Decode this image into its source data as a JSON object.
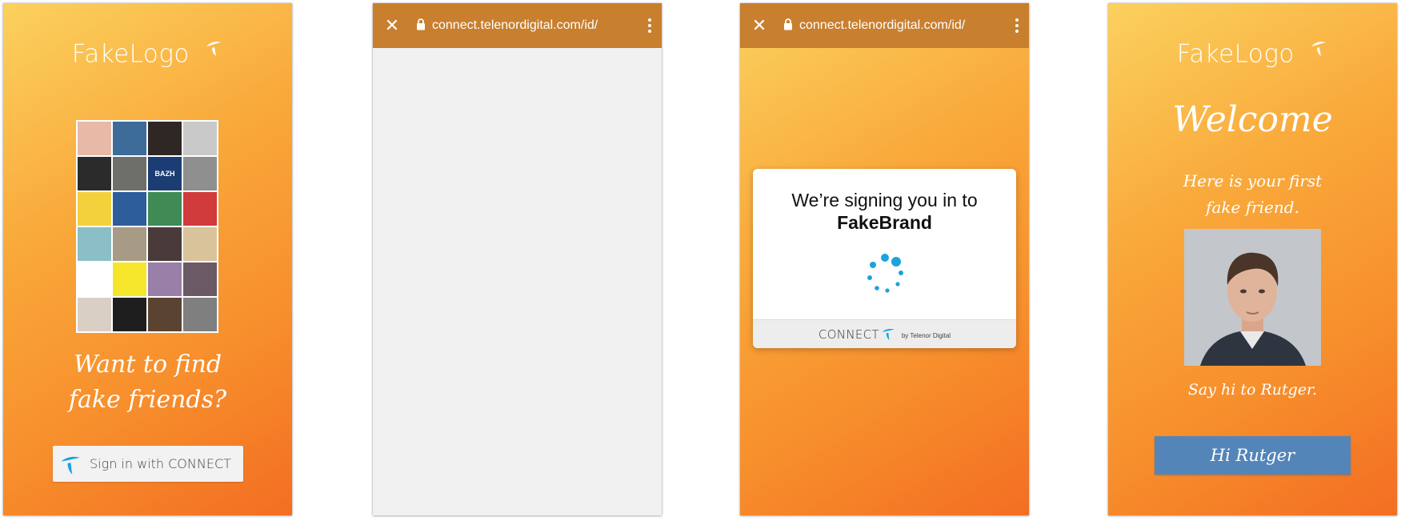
{
  "screen1": {
    "logo_text": "FakeLogo",
    "headline_line1": "Want to find",
    "headline_line2": "fake friends?",
    "signin_label": "Sign in with CONNECT",
    "avatar_tiles": [
      {
        "color": "#e7b9a6"
      },
      {
        "color": "#3d6b9a"
      },
      {
        "color": "#2e2724"
      },
      {
        "color": "#c9c9c9"
      },
      {
        "color": "#2b2b2b"
      },
      {
        "color": "#6f6f6a"
      },
      {
        "color": "#1b3d73",
        "label": "BAZH"
      },
      {
        "color": "#8f8f8f"
      },
      {
        "color": "#f2d13d"
      },
      {
        "color": "#2e5d9b"
      },
      {
        "color": "#3f8a55"
      },
      {
        "color": "#d23b3b"
      },
      {
        "color": "#8bbec6"
      },
      {
        "color": "#a79b86"
      },
      {
        "color": "#4a3a3a"
      },
      {
        "color": "#d8c39a"
      },
      {
        "color": "#ffffff"
      },
      {
        "color": "#f6e62b"
      },
      {
        "color": "#9a7fa8"
      },
      {
        "color": "#6b5a66"
      },
      {
        "color": "#d9cfc4"
      },
      {
        "color": "#1e1e1e"
      },
      {
        "color": "#5a4330"
      },
      {
        "color": "#7f7f7f"
      }
    ]
  },
  "screen2": {
    "url": "connect.telenordigital.com/id/"
  },
  "screen3": {
    "url": "connect.telenordigital.com/id/",
    "card_line1": "We’re signing you in to",
    "card_line2": "FakeBrand",
    "footer_brand": "CONNECT",
    "footer_by": "by Telenor Digital"
  },
  "screen4": {
    "logo_text": "FakeLogo",
    "welcome": "Welcome",
    "subtitle_line1": "Here is your first",
    "subtitle_line2": "fake friend.",
    "say_hi": "Say hi to Rutger.",
    "button_label": "Hi Rutger"
  },
  "colors": {
    "accent_blue": "#1ba3dd",
    "button_blue": "#5485b8",
    "chrome_bar": "#c87f2e",
    "orange_light": "#fbd15e",
    "orange_dark": "#f36e22"
  }
}
